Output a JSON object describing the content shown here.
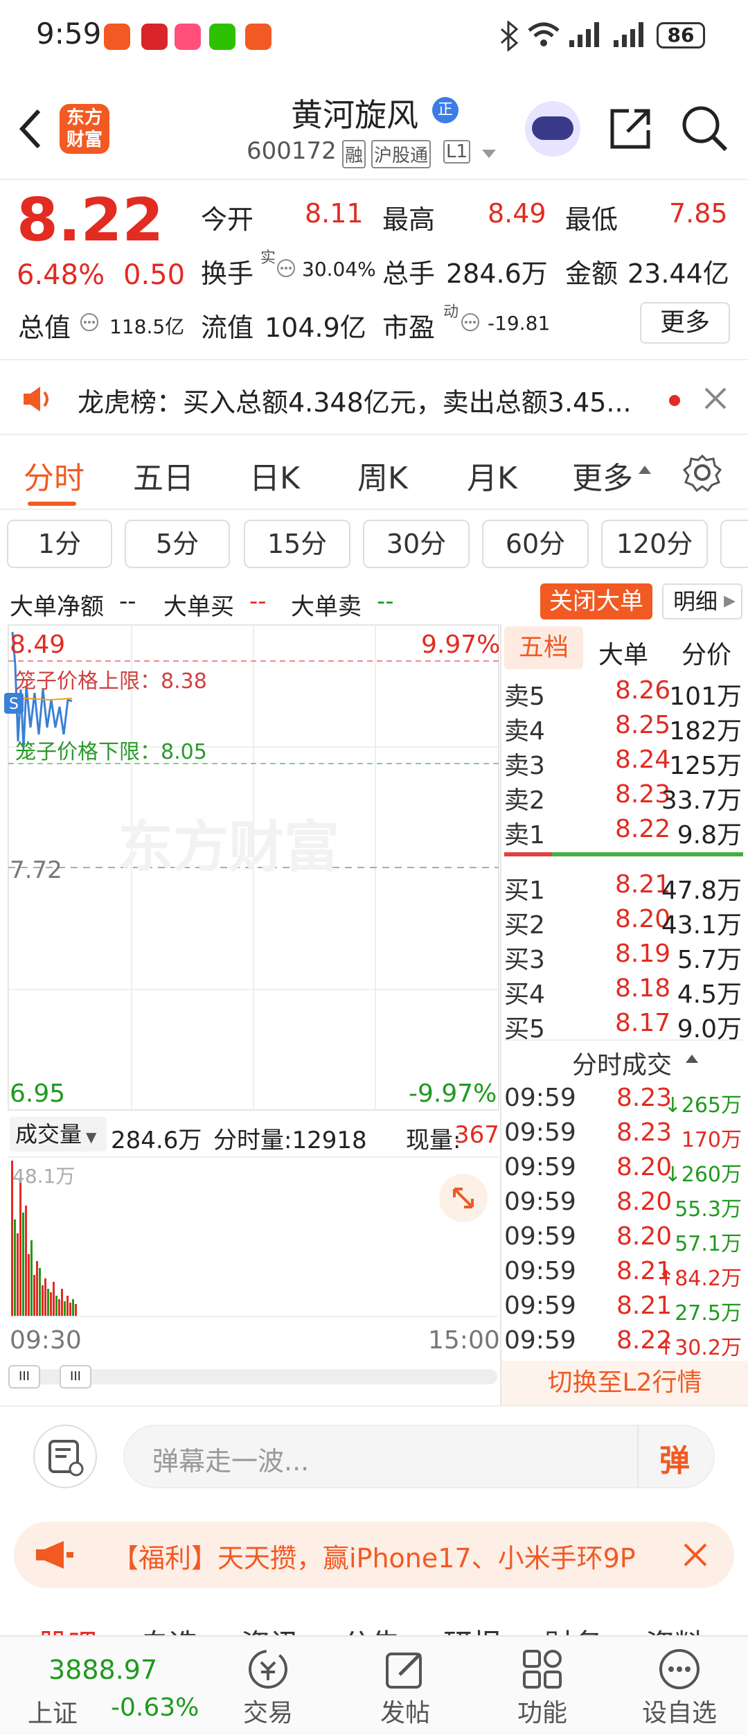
{
  "status": {
    "time": "9:59",
    "battery": "86"
  },
  "header": {
    "logo": "东方财富",
    "stock_name": "黄河旋风",
    "badge": "正",
    "code": "600172",
    "tag_rong": "融",
    "tag_hgt": "沪股通",
    "tag_l1": "L1"
  },
  "quote": {
    "price": "8.22",
    "change_pct": "6.48%",
    "change": "0.50",
    "open_label": "今开",
    "open": "8.11",
    "high_label": "最高",
    "high": "8.49",
    "low_label": "最低",
    "low": "7.85",
    "turnover_label": "换手",
    "turnover_sup": "实",
    "turnover": "30.04%",
    "volume_label": "总手",
    "volume": "284.6万",
    "amount_label": "金额",
    "amount": "23.44亿",
    "mcap_label": "总值",
    "mcap": "118.5亿",
    "float_label": "流值",
    "float": "104.9亿",
    "pe_label": "市盈",
    "pe_sup": "动",
    "pe": "-19.81",
    "more": "更多"
  },
  "notice": {
    "text": "龙虎榜：买入总额4.348亿元，卖出总额3.45..."
  },
  "chart_tabs": [
    "分时",
    "五日",
    "日K",
    "周K",
    "月K",
    "更多"
  ],
  "periods": [
    "1分",
    "5分",
    "15分",
    "30分",
    "60分",
    "120分"
  ],
  "bigorder": {
    "net_label": "大单净额",
    "net": "--",
    "buy_label": "大单买",
    "buy": "--",
    "sell_label": "大单卖",
    "sell": "--",
    "close_btn": "关闭大单",
    "detail_btn": "明细"
  },
  "chart": {
    "top_price": "8.49",
    "top_pct": "9.97%",
    "upper_limit": "笼子价格上限：8.38",
    "lower_limit": "笼子价格下限：8.05",
    "mid_price": "7.72",
    "bottom_price": "6.95",
    "bottom_pct": "-9.97%",
    "watermark": "东方财富",
    "vol_label": "成交量",
    "vol_total": "284.6万",
    "vol_minute_label": "分时量:12918",
    "vol_now_label": "现量:",
    "vol_now": "367",
    "vol_max": "48.1万",
    "time_start": "09:30",
    "time_end": "15:00"
  },
  "orderbook_tabs": [
    "五档",
    "大单",
    "分价"
  ],
  "asks": [
    {
      "label": "卖5",
      "price": "8.26",
      "vol": "101万"
    },
    {
      "label": "卖4",
      "price": "8.25",
      "vol": "182万"
    },
    {
      "label": "卖3",
      "price": "8.24",
      "vol": "125万"
    },
    {
      "label": "卖2",
      "price": "8.23",
      "vol": "33.7万"
    },
    {
      "label": "卖1",
      "price": "8.22",
      "vol": "9.8万"
    }
  ],
  "bids": [
    {
      "label": "买1",
      "price": "8.21",
      "vol": "47.8万"
    },
    {
      "label": "买2",
      "price": "8.20",
      "vol": "43.1万"
    },
    {
      "label": "买3",
      "price": "8.19",
      "vol": "5.7万"
    },
    {
      "label": "买4",
      "price": "8.18",
      "vol": "4.5万"
    },
    {
      "label": "买5",
      "price": "8.17",
      "vol": "9.0万"
    }
  ],
  "ticks_title": "分时成交",
  "ticks": [
    {
      "time": "09:59",
      "price": "8.23",
      "arrow": "↓",
      "vol": "265万",
      "dir": "down"
    },
    {
      "time": "09:59",
      "price": "8.23",
      "arrow": "",
      "vol": "170万",
      "dir": "up"
    },
    {
      "time": "09:59",
      "price": "8.20",
      "arrow": "↓",
      "vol": "260万",
      "dir": "down"
    },
    {
      "time": "09:59",
      "price": "8.20",
      "arrow": "",
      "vol": "55.3万",
      "dir": "down"
    },
    {
      "time": "09:59",
      "price": "8.20",
      "arrow": "",
      "vol": "57.1万",
      "dir": "down"
    },
    {
      "time": "09:59",
      "price": "8.21",
      "arrow": "↑",
      "vol": "84.2万",
      "dir": "up"
    },
    {
      "time": "09:59",
      "price": "8.21",
      "arrow": "",
      "vol": "27.5万",
      "dir": "down"
    },
    {
      "time": "09:59",
      "price": "8.22",
      "arrow": "↑",
      "vol": "30.2万",
      "dir": "up"
    }
  ],
  "l2_button": "切换至L2行情",
  "danmu": {
    "placeholder": "弹幕走一波...",
    "send": "弹"
  },
  "promo": {
    "text": "【福利】天天攒，赢iPhone17、小米手环9P"
  },
  "content_tabs": [
    "股吧",
    "自选",
    "资讯",
    "公告",
    "研报",
    "财务",
    "资料"
  ],
  "bottom": {
    "index_value": "3888.97",
    "index_name": "上证",
    "index_change": "-0.63%",
    "trade": "交易",
    "post": "发帖",
    "func": "功能",
    "add": "设自选"
  },
  "colors": {
    "accent": "#f15a22",
    "up": "#e22b21",
    "down": "#1e9a1e"
  }
}
